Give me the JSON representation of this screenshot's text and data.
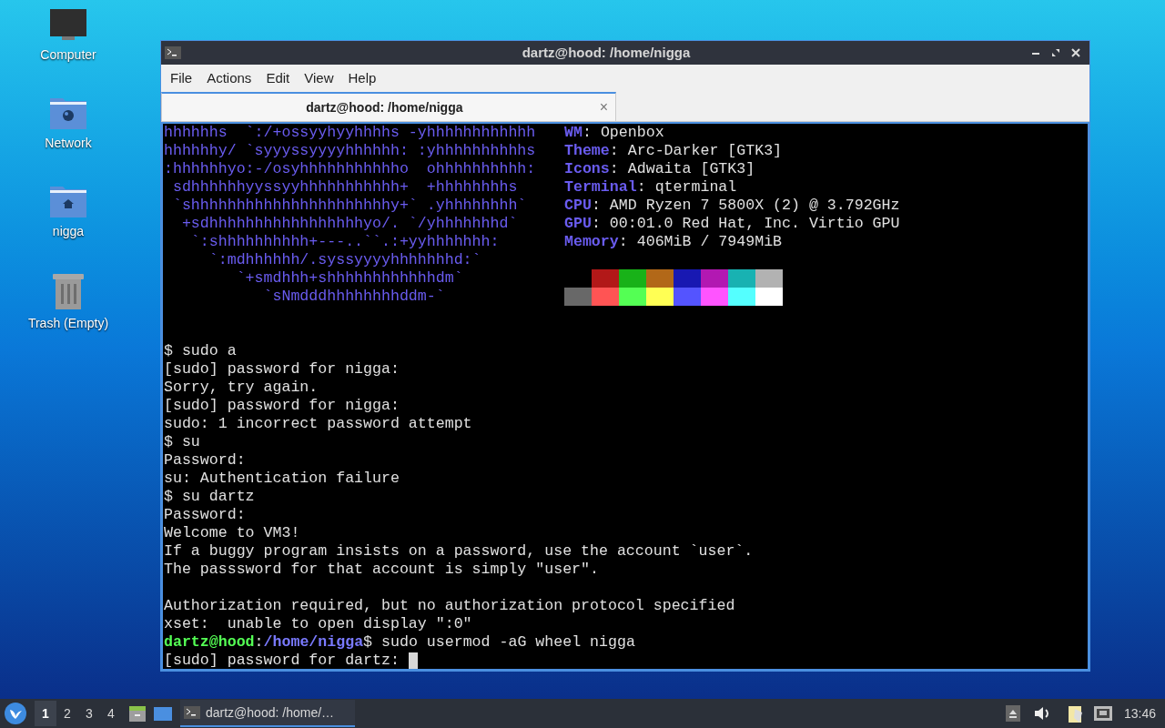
{
  "desktop_icons": [
    {
      "kind": "computer",
      "label": "Computer"
    },
    {
      "kind": "network",
      "label": "Network"
    },
    {
      "kind": "home",
      "label": "nigga"
    },
    {
      "kind": "trash",
      "label": "Trash (Empty)"
    }
  ],
  "window": {
    "title": "dartz@hood: /home/nigga",
    "menu": [
      "File",
      "Actions",
      "Edit",
      "View",
      "Help"
    ],
    "tabs": [
      {
        "label": "dartz@hood: /home/nigga",
        "selected": true,
        "close": "×"
      }
    ],
    "neofetch": {
      "logo_lines": [
        "hhhhhhs  `:/+ossyyhyyhhhhs -yhhhhhhhhhhhh",
        "hhhhhhy/ `syyyssyyyyhhhhhh: :yhhhhhhhhhhs",
        ":hhhhhhyo:-/osyhhhhhhhhhhho  ohhhhhhhhhh:",
        " sdhhhhhhyyssyyhhhhhhhhhhh+  +hhhhhhhhs",
        " `shhhhhhhhhhhhhhhhhhhhhhy+` .yhhhhhhhh`",
        "  +sdhhhhhhhhhhhhhhhhhyo/. `/yhhhhhhhd`",
        "   `:shhhhhhhhhh+---..``.:+yyhhhhhhh:",
        "     `:mdhhhhhh/.syssyyyyhhhhhhhd:`",
        "        `+smdhhh+shhhhhhhhhhhhdm`",
        "           `sNmdddhhhhhhhhddm-`"
      ],
      "info": [
        {
          "key": "WM",
          "sep": ":",
          "value": "Openbox"
        },
        {
          "key": "Theme",
          "sep": ":",
          "value": "Arc-Darker [GTK3]"
        },
        {
          "key": "Icons",
          "sep": ":",
          "value": "Adwaita [GTK3]"
        },
        {
          "key": "Terminal",
          "sep": ":",
          "value": "qterminal"
        },
        {
          "key": "CPU",
          "sep": ":",
          "value": "AMD Ryzen 7 5800X (2) @ 3.792GHz"
        },
        {
          "key": "GPU",
          "sep": ":",
          "value": "00:01.0 Red Hat, Inc. Virtio GPU"
        },
        {
          "key": "Memory",
          "sep": ":",
          "value": "406MiB / 7949MiB"
        }
      ],
      "palette": [
        [
          {
            "color": "#b21818"
          },
          {
            "color": "#18b218"
          },
          {
            "color": "#b26818"
          },
          {
            "color": "#1818b2"
          },
          {
            "color": "#b218b2"
          },
          {
            "color": "#18b2b2"
          },
          {
            "color": "#b2b2b2"
          }
        ],
        [
          {
            "color": "#686868"
          },
          {
            "color": "#ff5454"
          },
          {
            "color": "#54ff54"
          },
          {
            "color": "#ffff54"
          },
          {
            "color": "#5454ff"
          },
          {
            "color": "#ff54ff"
          },
          {
            "color": "#54ffff"
          },
          {
            "color": "#ffffff"
          }
        ]
      ]
    },
    "session_lines": [
      {
        "kind": "blank"
      },
      {
        "kind": "blank"
      },
      {
        "kind": "plain",
        "text": "$ sudo a"
      },
      {
        "kind": "plain",
        "text": "[sudo] password for nigga:"
      },
      {
        "kind": "plain",
        "text": "Sorry, try again."
      },
      {
        "kind": "plain",
        "text": "[sudo] password for nigga:"
      },
      {
        "kind": "plain",
        "text": "sudo: 1 incorrect password attempt"
      },
      {
        "kind": "plain",
        "text": "$ su"
      },
      {
        "kind": "plain",
        "text": "Password:"
      },
      {
        "kind": "plain",
        "text": "su: Authentication failure"
      },
      {
        "kind": "plain",
        "text": "$ su dartz"
      },
      {
        "kind": "plain",
        "text": "Password:"
      },
      {
        "kind": "plain",
        "text": "Welcome to VM3!"
      },
      {
        "kind": "plain",
        "text": "If a buggy program insists on a password, use the account `user`."
      },
      {
        "kind": "plain",
        "text": "The passsword for that account is simply \"user\"."
      },
      {
        "kind": "blank"
      },
      {
        "kind": "plain",
        "text": "Authorization required, but no authorization protocol specified"
      },
      {
        "kind": "plain",
        "text": "xset:  unable to open display \":0\""
      },
      {
        "kind": "prompt",
        "user": "dartz@hood",
        "sep": ":",
        "path": "/home/nigga",
        "command": "$ sudo usermod -aG wheel nigga"
      },
      {
        "kind": "cursor",
        "text": "[sudo] password for dartz:"
      }
    ]
  },
  "taskbar": {
    "workspaces": [
      {
        "label": "1",
        "selected": true
      },
      {
        "label": "2",
        "selected": false
      },
      {
        "label": "3",
        "selected": false
      },
      {
        "label": "4",
        "selected": false
      }
    ],
    "tasks": [
      {
        "label": "dartz@hood: /home/…",
        "selected": true
      }
    ],
    "clock": "13:46"
  }
}
